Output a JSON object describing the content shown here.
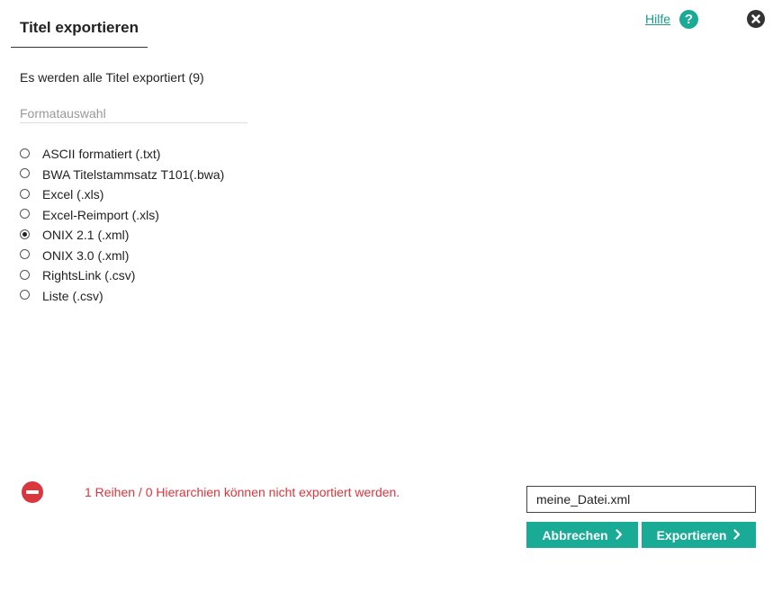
{
  "header": {
    "title": "Titel exportieren",
    "help_label": "Hilfe",
    "help_icon": "question-circle-icon",
    "close_icon": "close-circle-icon"
  },
  "main": {
    "info_text": "Es werden alle Titel exportiert (9)",
    "format_label": "Formatauswahl",
    "formats": [
      {
        "label": "ASCII formatiert (.txt)",
        "checked": false
      },
      {
        "label": "BWA Titelstammsatz T101(.bwa)",
        "checked": false
      },
      {
        "label": "Excel (.xls)",
        "checked": false
      },
      {
        "label": "Excel-Reimport (.xls)",
        "checked": false
      },
      {
        "label": "ONIX 2.1 (.xml)",
        "checked": true
      },
      {
        "label": "ONIX 3.0 (.xml)",
        "checked": false
      },
      {
        "label": "RightsLink (.csv)",
        "checked": false
      },
      {
        "label": "Liste (.csv)",
        "checked": false
      }
    ]
  },
  "footer": {
    "error_icon": "minus-circle-icon",
    "error_text": "1 Reihen / 0 Hierarchien können nicht exportiert werden.",
    "filename_value": "meine_Datei.xml",
    "cancel_label": "Abbrechen",
    "export_label": "Exportieren"
  },
  "colors": {
    "accent": "#1aab97",
    "error": "#d9363e",
    "link": "#1a9b8a"
  }
}
